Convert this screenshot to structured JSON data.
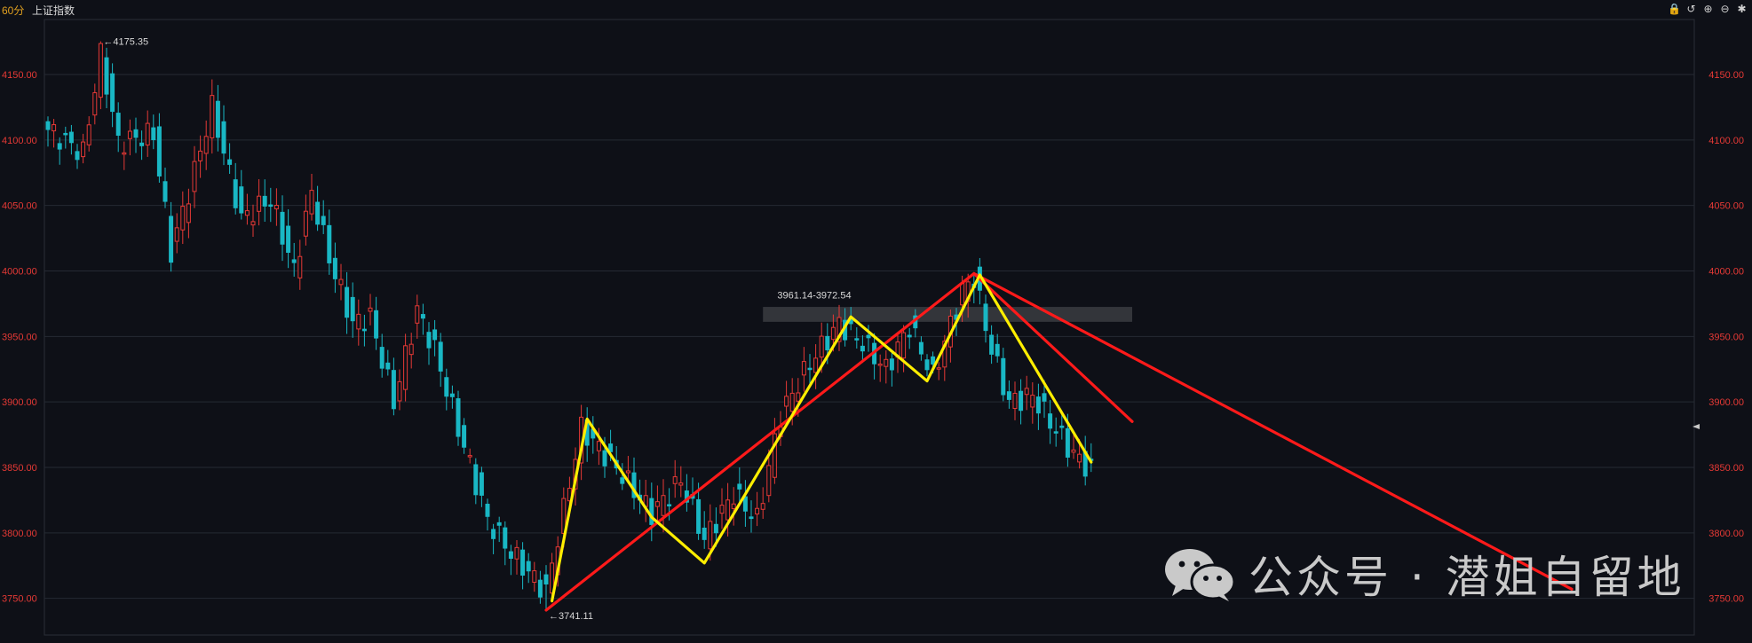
{
  "header": {
    "period": "60分",
    "symbol": "上证指数",
    "tools": [
      {
        "name": "lock-icon",
        "glyph": "🔒"
      },
      {
        "name": "undo-icon",
        "glyph": "↺"
      },
      {
        "name": "zoom-in-icon",
        "glyph": "⊕"
      },
      {
        "name": "zoom-out-icon",
        "glyph": "⊖"
      },
      {
        "name": "settings-icon",
        "glyph": "✱"
      }
    ]
  },
  "watermark": {
    "text": "公众号 · 潜姐自留地"
  },
  "colors": {
    "background": "#0e1017",
    "grid": "#262a33",
    "up": "#e53935",
    "down": "#19b7c4",
    "axis_label": "#e53935",
    "trend_red": "#ff1a1a",
    "trend_yellow": "#ffee00",
    "annotation": "#d8d8d8"
  },
  "chart_data": {
    "type": "candlestick",
    "ylim": [
      3722,
      4192
    ],
    "yticks": [
      3750,
      3800,
      3850,
      3900,
      3950,
      4000,
      4050,
      4100,
      4150
    ],
    "ytick_labels": [
      "3750.00",
      "3800.00",
      "3850.00",
      "3900.00",
      "3950.00",
      "4000.00",
      "4050.00",
      "4100.00",
      "4150.00"
    ],
    "grid": true,
    "bar_count": 190,
    "annotations": [
      {
        "text": "4175.35",
        "bar": 9,
        "price": 4175.35
      },
      {
        "text": "3741.11",
        "bar": 85,
        "price": 3741.11
      },
      {
        "text": "3961.14-3972.54",
        "bar": 124,
        "price": 3975
      }
    ],
    "zone": {
      "bar_start": 122,
      "bar_end": 185,
      "price_low": 3961.14,
      "price_high": 3972.54
    },
    "key_points": [
      {
        "bar": 0,
        "close": 4108
      },
      {
        "bar": 6,
        "close": 4090
      },
      {
        "bar": 9,
        "close": 4165
      },
      {
        "bar": 12,
        "close": 4098
      },
      {
        "bar": 18,
        "close": 4105
      },
      {
        "bar": 21,
        "close": 4015
      },
      {
        "bar": 24,
        "close": 4060
      },
      {
        "bar": 28,
        "close": 4125
      },
      {
        "bar": 33,
        "close": 4040
      },
      {
        "bar": 38,
        "close": 4055
      },
      {
        "bar": 42,
        "close": 4000
      },
      {
        "bar": 45,
        "close": 4060
      },
      {
        "bar": 48,
        "close": 4010
      },
      {
        "bar": 52,
        "close": 3960
      },
      {
        "bar": 55,
        "close": 3965
      },
      {
        "bar": 59,
        "close": 3900
      },
      {
        "bar": 63,
        "close": 3970
      },
      {
        "bar": 66,
        "close": 3940
      },
      {
        "bar": 70,
        "close": 3880
      },
      {
        "bar": 75,
        "close": 3810
      },
      {
        "bar": 79,
        "close": 3785
      },
      {
        "bar": 84,
        "close": 3760
      },
      {
        "bar": 85,
        "close": 3755
      },
      {
        "bar": 91,
        "close": 3880
      },
      {
        "bar": 97,
        "close": 3850
      },
      {
        "bar": 103,
        "close": 3815
      },
      {
        "bar": 108,
        "close": 3840
      },
      {
        "bar": 112,
        "close": 3795
      },
      {
        "bar": 117,
        "close": 3830
      },
      {
        "bar": 121,
        "close": 3810
      },
      {
        "bar": 125,
        "close": 3890
      },
      {
        "bar": 130,
        "close": 3930
      },
      {
        "bar": 135,
        "close": 3960
      },
      {
        "bar": 139,
        "close": 3945
      },
      {
        "bar": 143,
        "close": 3925
      },
      {
        "bar": 147,
        "close": 3958
      },
      {
        "bar": 151,
        "close": 3920
      },
      {
        "bar": 156,
        "close": 3985
      },
      {
        "bar": 158,
        "close": 3995
      },
      {
        "bar": 161,
        "close": 3940
      },
      {
        "bar": 164,
        "close": 3900
      },
      {
        "bar": 168,
        "close": 3905
      },
      {
        "bar": 171,
        "close": 3885
      },
      {
        "bar": 175,
        "close": 3860
      },
      {
        "bar": 178,
        "close": 3848
      }
    ],
    "trendlines": [
      {
        "color": "red",
        "points": [
          {
            "bar": 85,
            "price": 3741
          },
          {
            "bar": 158,
            "price": 3998
          },
          {
            "bar": 185,
            "price": 3885
          }
        ]
      },
      {
        "color": "red",
        "points": [
          {
            "bar": 158,
            "price": 3998
          },
          {
            "bar": 260,
            "price": 3757
          }
        ]
      },
      {
        "color": "yellow",
        "points": [
          {
            "bar": 86,
            "price": 3748
          },
          {
            "bar": 92,
            "price": 3887
          },
          {
            "bar": 103,
            "price": 3812
          },
          {
            "bar": 112,
            "price": 3777
          },
          {
            "bar": 137,
            "price": 3965
          },
          {
            "bar": 150,
            "price": 3916
          },
          {
            "bar": 159,
            "price": 3997
          },
          {
            "bar": 178,
            "price": 3854
          }
        ]
      }
    ]
  }
}
